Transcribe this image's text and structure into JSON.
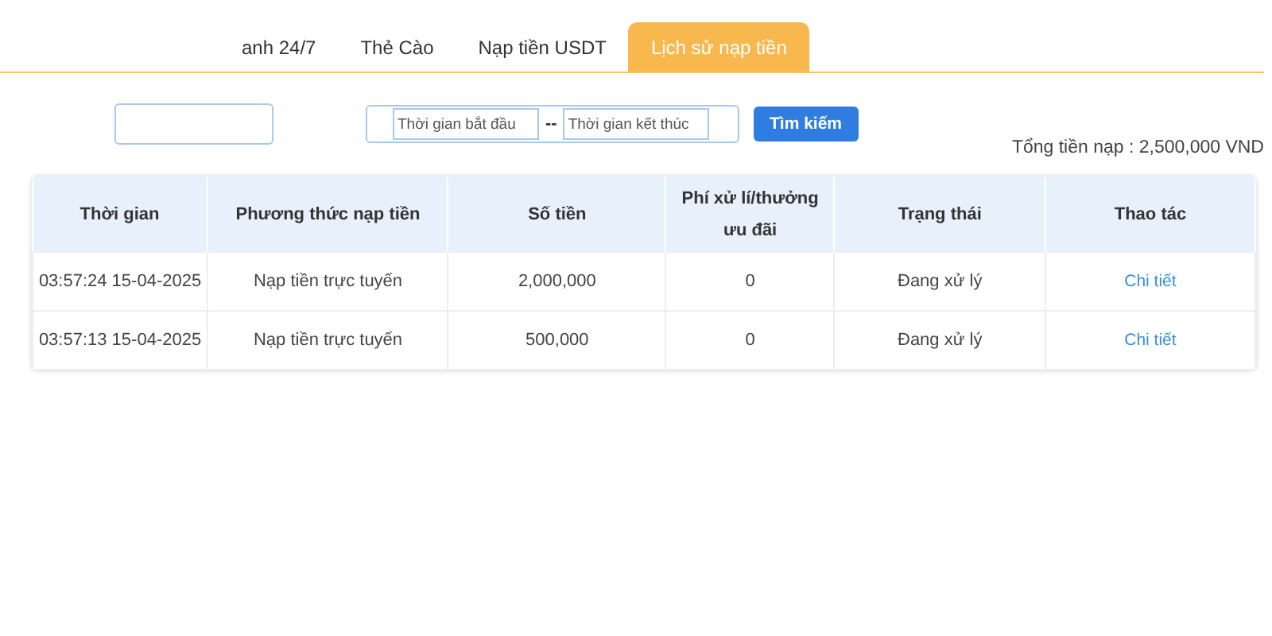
{
  "tabs": [
    {
      "label": "anh 24/7",
      "selected": false
    },
    {
      "label": "Thẻ Cào",
      "selected": false
    },
    {
      "label": "Nạp tiền USDT",
      "selected": false
    },
    {
      "label": "Lịch sử nạp tiền",
      "selected": true
    }
  ],
  "filter": {
    "start_placeholder": "Thời gian bắt đầu",
    "separator": "--",
    "end_placeholder": "Thời gian kết thúc",
    "search_button": "Tìm kiếm"
  },
  "total": "Tổng tiền nạp : 2,500,000 VND",
  "table": {
    "columns": [
      "Thời gian",
      "Phương thức nạp tiền",
      "Số tiền",
      "Phí xử lí/thưởng ưu đãi",
      "Trạng thái",
      "Thao tác"
    ],
    "rows": [
      {
        "time": "03:57:24 15-04-2025",
        "method": "Nạp tiền trực tuyến",
        "amount": "2,000,000",
        "fee": "0",
        "status": "Đang xử lý",
        "action": "Chi tiết"
      },
      {
        "time": "03:57:13 15-04-2025",
        "method": "Nạp tiền trực tuyến",
        "amount": "500,000",
        "fee": "0",
        "status": "Đang xử lý",
        "action": "Chi tiết"
      }
    ]
  }
}
